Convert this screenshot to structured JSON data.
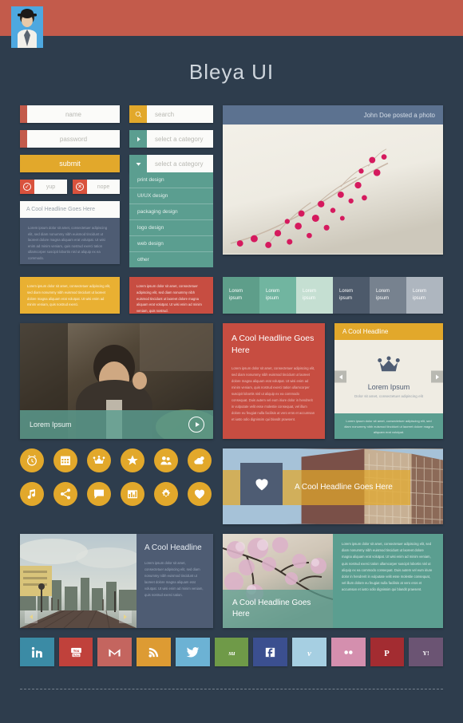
{
  "page": {
    "title": "Bleya UI",
    "background": "#2e3d4d",
    "topbar_color": "#c35b4b"
  },
  "form": {
    "name_placeholder": "name",
    "password_placeholder": "password",
    "submit_label": "submit",
    "yes_label": "yup",
    "no_label": "nope",
    "search_placeholder": "search",
    "select_placeholder_1": "select a category",
    "select_placeholder_2": "select a category",
    "search_icon": "search-icon",
    "caret_right_icon": "caret-right-icon",
    "caret_down_icon": "caret-down-icon",
    "yes_icon": "check-circle-icon",
    "no_icon": "x-circle-icon"
  },
  "dropdown": {
    "options": [
      "print design",
      "UI/UX design",
      "packaging design",
      "logo design",
      "web design",
      "other"
    ]
  },
  "text_card": {
    "heading": "A Cool Headline Goes Here",
    "body": "Lorem ipsum dolor sit amet, consectetuer adipiscing elit, sed diam nonummy nibh euismod tincidunt ut laoreet dolore magna aliquam erat volutpat. Ut wisi enim ad minim veniam, quis nostrud exerci tation ullamcorper suscipit lobortis nisl ut aliquip ex ea commodo."
  },
  "post": {
    "status_text": "John Doe posted a photo",
    "avatar_name": "avatar"
  },
  "alerts": [
    {
      "color": "#e9b032",
      "text": "Lorem ipsum dolor sit amet, consectetuer adipiscing elit, sed diam nonummy nibh euismod tincidunt ut laoreet dolore magna aliquam erat volutpat. Ut wisi enim ad minim veniam, quis nostrud exerci."
    },
    {
      "color": "#c74d41",
      "text": "Lorem ipsum dolor sit amet, consectetuer adipiscing elit, sed diam nonummy nibh euismod tincidunt ut laoreet dolore magna aliquam erat volutpat. Ut wisi enim ad minim veniam, quis nostrud."
    }
  ],
  "stats": [
    {
      "line1": "Lorem",
      "line2": "ipsum",
      "color": "#5e9e8a"
    },
    {
      "line1": "Lorem",
      "line2": "ipsum",
      "color": "#71b5a0"
    },
    {
      "line1": "Lorem",
      "line2": "ipsum",
      "color": "#c5dfd2"
    },
    {
      "line1": "Lorem",
      "line2": "ipsum",
      "color": "#4d5a6b"
    },
    {
      "line1": "Lorem",
      "line2": "ipsum",
      "color": "#77828f"
    },
    {
      "line1": "Lorem",
      "line2": "ipsum",
      "color": "#aeb6bf"
    }
  ],
  "video_card": {
    "caption": "Lorem Ipsum",
    "play_icon": "play-icon"
  },
  "headline_card": {
    "heading": "A Cool Headline Goes Here",
    "body": "Lorem ipsum dolor sit amet, consectetuer adipiscing elit, sed diam nonummy nibh euismod tincidunt ut laoreet dolore magna aliquam erat volutpat. Ut wisi enim ad minim veniam, quis nostrud exerci tation ullamcorper suscipit lobortis nisl ut aliquip ex ea commodo consequat. Duis autem vel eum iriure dolor in hendrerit in vulputate velit esse molestie consequat, vel illum dolore eu feugiat nulla facilisis at vero eros et accumsan et iusto odio dignissim qui blandit praesent."
  },
  "carousel": {
    "header": "A Cool Headline",
    "icon": "crown-icon",
    "title": "Lorem Ipsum",
    "subtitle": "Dolor sit amet, consectetuer adipiscing elit",
    "footer": "Lorem ipsum dolor sit amet, consectetuer adipiscing elit, sed diam nonummy nibh euismod tincidunt ut laoreet dolore magna aliquam erat volutpat.",
    "prev_label": "prev-arrow",
    "next_label": "next-arrow"
  },
  "icon_grid": [
    "alarm-clock-icon",
    "calendar-icon",
    "crown-icon",
    "star-icon",
    "people-icon",
    "weather-cloud-icon",
    "music-note-icon",
    "share-icon",
    "chat-bubble-icon",
    "bar-chart-icon",
    "gear-icon",
    "heart-icon"
  ],
  "banner": {
    "heading": "A Cool Headline Goes Here",
    "icon": "heart-icon",
    "band_color": "#e2a82b"
  },
  "bottom_left_card": {
    "heading": "A Cool Headline",
    "body": "Lorem ipsum dolor sit amet, consectetuer adipiscing elit, sed diam nonummy nibh euismod tincidunt ut laoreet dolore magna aliquam erat volutpat. Ut wisi enim ad minim veniam, quis nostrud exerci tation.",
    "prev_icon": "prev-arrow-icon",
    "next_icon": "next-arrow-icon"
  },
  "bottom_right_card": {
    "heading": "A Cool Headline Goes Here",
    "body": "Lorem ipsum dolor sit amet, consectetuer adipiscing elit, sed diam nonummy nibh euismod tincidunt ut laoreet dolore magna aliquam erat volutpat. Ut wisi enim ad minim veniam, quis nostrud exerci tation ullamcorper suscipit lobortis nisl ut aliquip ex ea commodo consequat. Duis autem vel eum iriure dolor in hendrerit in vulputate velit esse molestie consequat, vel illum dolore eu feugiat nulla facilisis at vero eros et accumsan et iusto odio dignissim qui blandit praesent."
  },
  "socials": [
    {
      "name": "linkedin",
      "label": "in",
      "color": "#3b8ba5"
    },
    {
      "name": "youtube",
      "label": "You Tube",
      "color": "#c0413b"
    },
    {
      "name": "gmail",
      "label": "M",
      "color": "#c4655f"
    },
    {
      "name": "rss",
      "label": "rss",
      "color": "#dd9b33"
    },
    {
      "name": "twitter",
      "label": "twitter",
      "color": "#6cb2d4"
    },
    {
      "name": "stumbleupon",
      "label": "su",
      "color": "#6f9a48"
    },
    {
      "name": "facebook",
      "label": "f",
      "color": "#3b4f8f"
    },
    {
      "name": "vimeo",
      "label": "v",
      "color": "#a6cfe2"
    },
    {
      "name": "flickr",
      "label": "flickr",
      "color": "#d48fae"
    },
    {
      "name": "pinterest",
      "label": "P",
      "color": "#a32c31"
    },
    {
      "name": "yahoo",
      "label": "Y!",
      "color": "#6b5473"
    }
  ]
}
